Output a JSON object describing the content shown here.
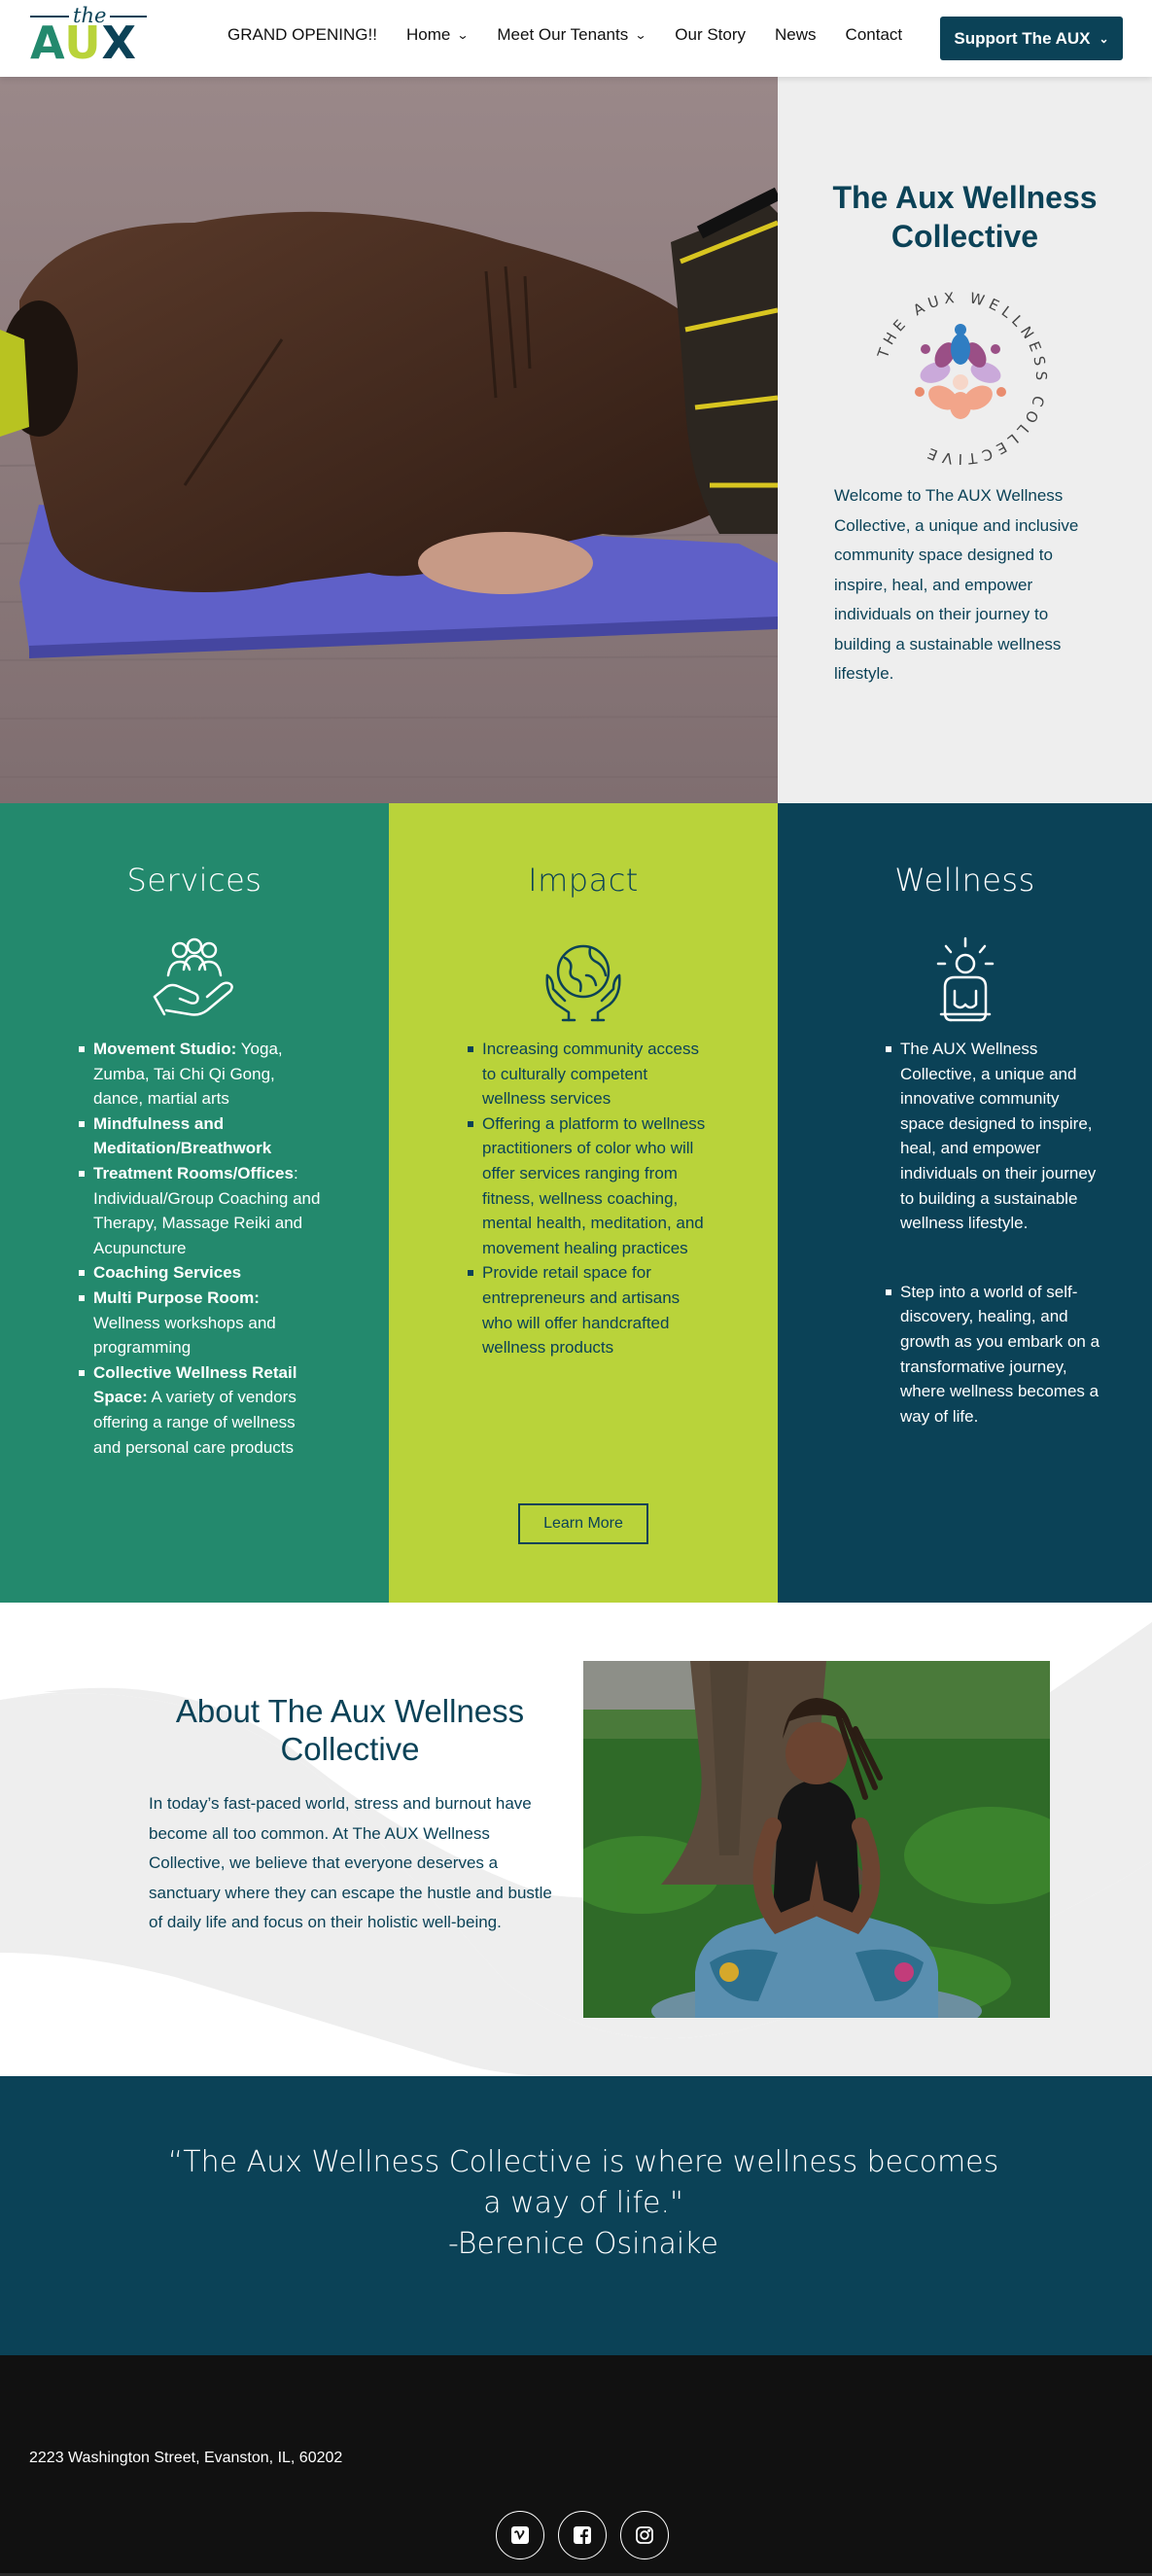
{
  "header": {
    "logo": {
      "the": "the",
      "aux_a": "A",
      "aux_u": "U",
      "aux_x": "X"
    },
    "nav": [
      {
        "label": "GRAND OPENING!!",
        "dropdown": false
      },
      {
        "label": "Home",
        "dropdown": true
      },
      {
        "label": "Meet Our Tenants",
        "dropdown": true
      },
      {
        "label": "Our Story",
        "dropdown": false
      },
      {
        "label": "News",
        "dropdown": false
      },
      {
        "label": "Contact",
        "dropdown": false
      }
    ],
    "cta": {
      "label": "Support The AUX",
      "dropdown": true
    }
  },
  "hero": {
    "title_line1": "The Aux Wellness",
    "title_line2": "Collective",
    "emblem_text": "THE AUX WELLNESS COLLECTIVE",
    "intro": "Welcome to The AUX Wellness Collective, a unique and inclusive community space designed to inspire, heal, and empower individuals on their journey to building a sustainable wellness lifestyle."
  },
  "services": {
    "title": "Services",
    "icon": "community-hand-icon",
    "items": [
      {
        "bold": "Movement Studio:",
        "text": " Yoga, Zumba, Tai Chi Qi Gong, dance, martial arts"
      },
      {
        "bold": "Mindfulness and Meditation/Breathwork",
        "text": ""
      },
      {
        "bold": "Treatment Rooms/Offices",
        "text": ": Individual/Group Coaching and Therapy, Massage Reiki and Acupuncture"
      },
      {
        "bold": "Coaching Services",
        "text": ""
      },
      {
        "bold": "Multi Purpose Room:",
        "text": " Wellness workshops and programming"
      },
      {
        "bold": "Collective Wellness Retail Space:",
        "text": " A variety of vendors offering a range of wellness and personal care products"
      }
    ]
  },
  "impact": {
    "title": "Impact",
    "icon": "globe-hands-icon",
    "items": [
      "Increasing community access to culturally competent wellness services",
      "Offering a platform to wellness practitioners of color who will offer services ranging from fitness, wellness coaching, mental health, meditation, and movement healing practices",
      "Provide retail space for entrepreneurs and artisans who will offer handcrafted wellness products"
    ],
    "button": "Learn More"
  },
  "wellness": {
    "title": "Wellness",
    "icon": "meditation-icon",
    "items": [
      "The AUX Wellness Collective, a unique and innovative community space designed to inspire, heal, and empower individuals on their journey to building a sustainable wellness lifestyle.",
      "Step into a world of self-discovery, healing, and growth as you embark on a transformative journey, where wellness becomes a way of life."
    ]
  },
  "about": {
    "title": "About The Aux Wellness Collective",
    "text": "In today’s fast-paced world, stress and burnout have become all too common. At The AUX Wellness Collective, we believe that everyone deserves a sanctuary where they can escape the hustle and bustle of daily life and focus on their holistic well-being."
  },
  "quote": {
    "line1": "“The Aux Wellness Collective is where wellness becomes",
    "line2": "a way of life.\"",
    "line3": "-Berenice Osinaike"
  },
  "footer": {
    "address": "2223 Washington Street, Evanston, IL, 60202",
    "social": [
      "vimeo-icon",
      "facebook-icon",
      "instagram-icon"
    ]
  },
  "colors": {
    "navy": "#0b4257",
    "green": "#23896d",
    "lime": "#b9d33a",
    "light_gray": "#eeeeee",
    "footer_black": "#111111"
  }
}
